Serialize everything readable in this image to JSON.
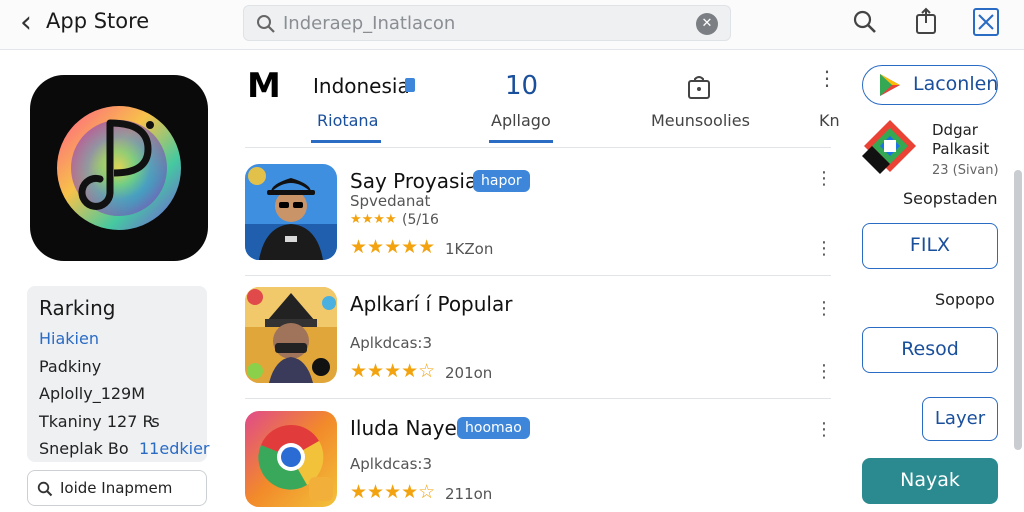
{
  "topbar": {
    "back_glyph": "‹",
    "title": "App Store",
    "search_text": "Inderaep_Inatlacon",
    "icons": [
      "back-icon",
      "search-icon",
      "clear-icon",
      "search-icon",
      "share-icon",
      "close-icon"
    ]
  },
  "left": {
    "ranking": {
      "heading": "Rarking",
      "lines": [
        "Hiakien",
        "Padkiny",
        "Aplolly_129M",
        "Tkaniny 127 ₨"
      ],
      "last_line": {
        "label": "Sneplak Bo",
        "value": "11edkier"
      }
    },
    "search_text": "Ioide Inapmem"
  },
  "header": {
    "logo_glyph": "M",
    "country": "Indonesia",
    "number": "10",
    "tabs": [
      "Riotana",
      "Apllago",
      "Meunsoolies",
      "Kn"
    ]
  },
  "apps": [
    {
      "name": "Say Proyasia",
      "badge": "hapor",
      "sub": "Spvedanat",
      "small_stars": "★★★★",
      "small_count": "(5/16",
      "stars": "★★★★★",
      "count": "1KZon"
    },
    {
      "name": "Aplkarí í Popular",
      "badge": "",
      "sub": "Aplkdcas:3",
      "stars": "★★★★☆",
      "count": "201on"
    },
    {
      "name": "Iluda Nayer",
      "badge": "hoomao",
      "sub": "Aplkdcas:3",
      "stars": "★★★★☆",
      "count": "211on"
    }
  ],
  "right": {
    "launch_label": "Laconlen",
    "dev_name_1": "Ddgar",
    "dev_name_2": "Palkasit",
    "dev_meta": "23 (Sivan)",
    "line1": "Seopstaden",
    "btn_filx": "FILX",
    "line2": "Sopopo",
    "btn_resod": "Resod",
    "btn_layer": "Layer",
    "btn_nayak": "Nayak"
  },
  "colors": {
    "accent": "#2a6bc4",
    "badge": "#3d86d9",
    "star": "#f2a30f",
    "teal": "#2a8a8f"
  }
}
